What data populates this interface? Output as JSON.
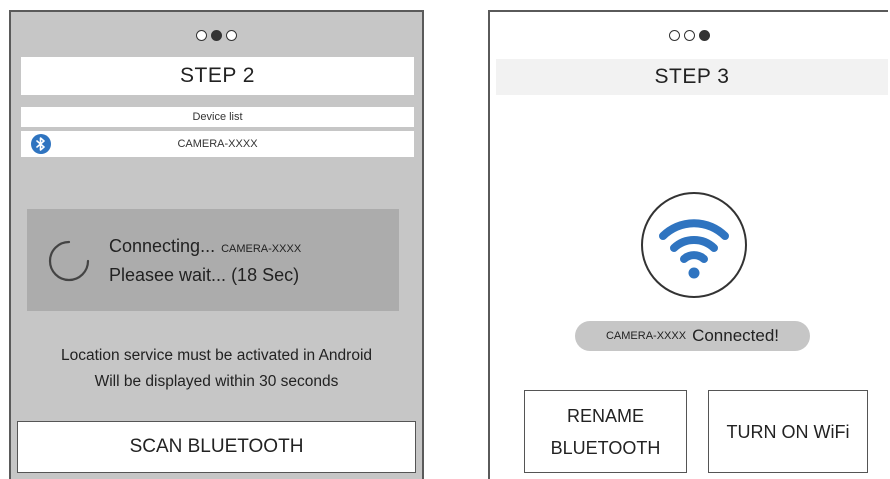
{
  "step2": {
    "title": "STEP 2",
    "page_dots": {
      "count": 3,
      "active_index": 1
    },
    "device_list_header": "Device list",
    "device_name": "CAMERA-XXXX",
    "device_icon": "bluetooth-icon",
    "connecting_text": "Connecting...",
    "connecting_device": "CAMERA-XXXX",
    "wait_text": "Pleasee wait... (18 Sec)",
    "notice_line1": "Location service must be activated in Android",
    "notice_line2": "Will be displayed within 30 seconds",
    "scan_button": "SCAN BLUETOOTH"
  },
  "step3": {
    "title": "STEP 3",
    "page_dots": {
      "count": 3,
      "active_index": 2
    },
    "status_icon": "wifi-icon",
    "connected_device": "CAMERA-XXXX",
    "connected_text": "Connected!",
    "rename_button_line1": "RENAME",
    "rename_button_line2": "BLUETOOTH",
    "wifi_button": "TURN ON WiFi"
  },
  "colors": {
    "screen_bg_step2": "#c6c6c6",
    "connect_box_bg": "#acacac",
    "bluetooth_blue": "#2f74c0",
    "wifi_blue": "#2f74c0"
  }
}
